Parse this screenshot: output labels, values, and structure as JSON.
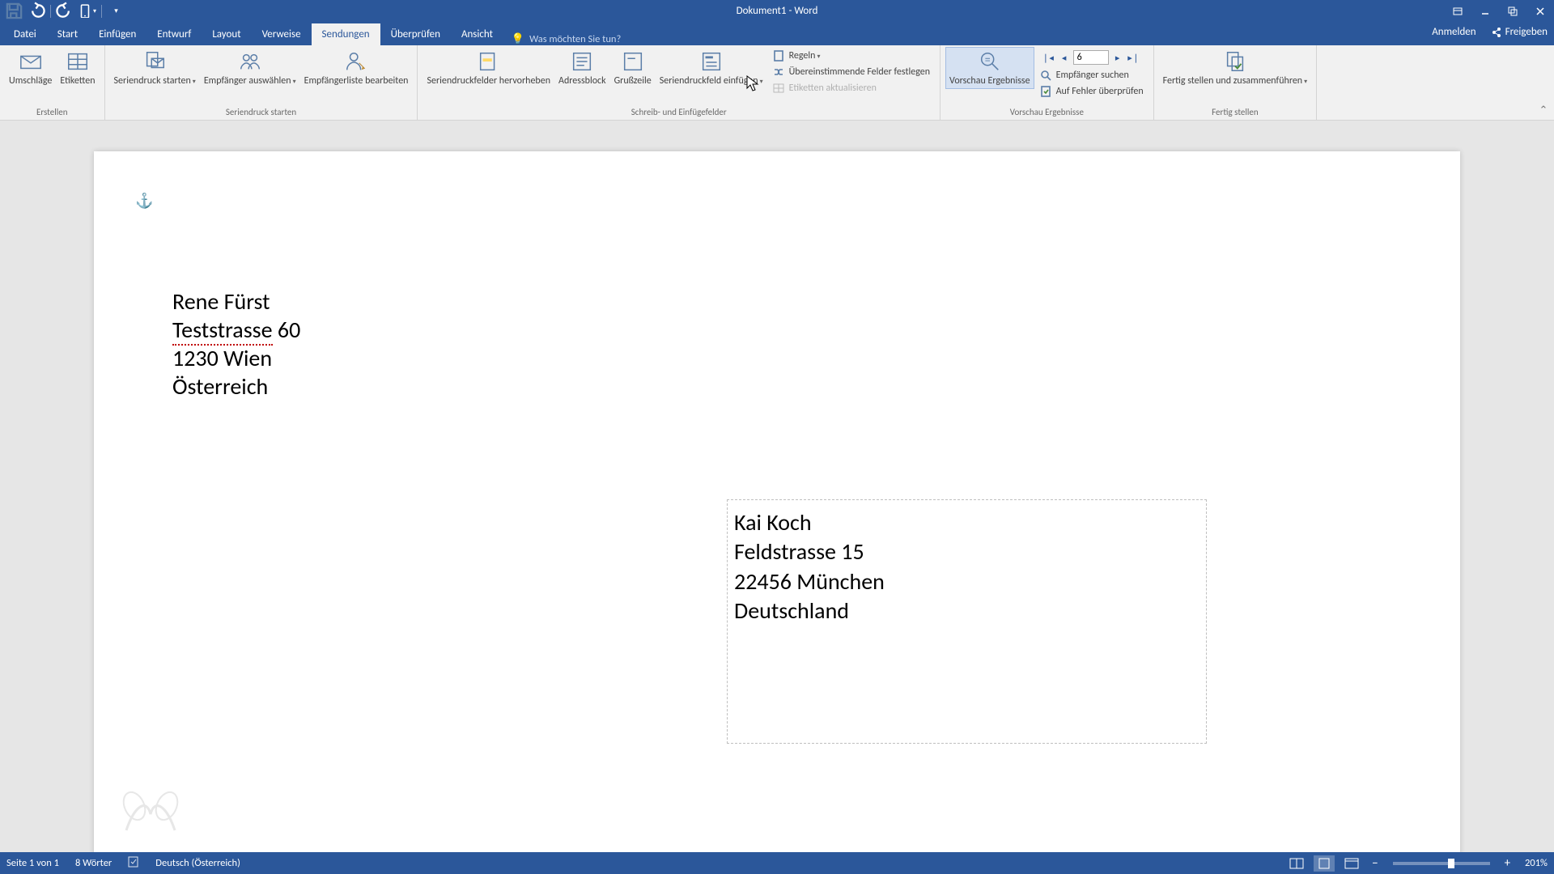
{
  "qat": {
    "save": "save",
    "undo": "undo",
    "redo": "redo",
    "touch": "touch-mode"
  },
  "title": "Dokument1 - Word",
  "tabs": {
    "file": "Datei",
    "home": "Start",
    "insert": "Einfügen",
    "design": "Entwurf",
    "layout": "Layout",
    "references": "Verweise",
    "mailings": "Sendungen",
    "review": "Überprüfen",
    "view": "Ansicht"
  },
  "tellme_placeholder": "Was möchten Sie tun?",
  "signin": "Anmelden",
  "share": "Freigeben",
  "ribbon": {
    "create": {
      "label": "Erstellen",
      "envelopes": "Umschläge",
      "labels": "Etiketten"
    },
    "startmm": {
      "label": "Seriendruck starten",
      "start": "Seriendruck starten",
      "select": "Empfänger auswählen",
      "edit": "Empfängerliste bearbeiten"
    },
    "writefields": {
      "label": "Schreib- und Einfügefelder",
      "highlight": "Seriendruckfelder hervorheben",
      "address": "Adressblock",
      "greeting": "Grußzeile",
      "insertfield": "Seriendruckfeld einfügen",
      "rules": "Regeln",
      "match": "Übereinstimmende Felder festlegen",
      "update": "Etiketten aktualisieren"
    },
    "preview": {
      "label": "Vorschau Ergebnisse",
      "button": "Vorschau Ergebnisse",
      "record": "6",
      "find": "Empfänger suchen",
      "check": "Auf Fehler überprüfen"
    },
    "finish": {
      "label": "Fertig stellen",
      "button": "Fertig stellen und zusammenführen"
    }
  },
  "document": {
    "sender": {
      "name": "Rene Fürst",
      "street_word": "Teststrasse",
      "street_num": "60",
      "city": "1230 Wien",
      "country": "Österreich"
    },
    "recipient": {
      "name": "Kai Koch",
      "street": "Feldstrasse 15",
      "city": "22456 München",
      "country": "Deutschland"
    }
  },
  "status": {
    "page": "Seite 1 von 1",
    "words": "8 Wörter",
    "lang": "Deutsch (Österreich)",
    "zoom": "201%"
  }
}
